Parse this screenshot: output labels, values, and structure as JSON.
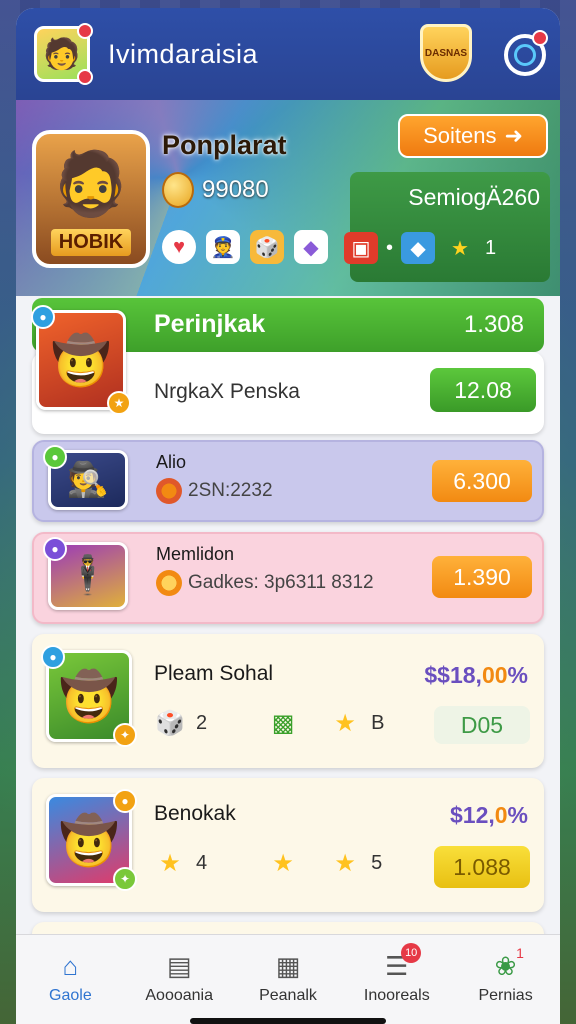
{
  "header": {
    "app_title": "Ivimdaraisia",
    "badge_text": "DASNAS",
    "avatar_icon": "player-avatar"
  },
  "hero": {
    "player_name": "Ponplarat",
    "portrait_tag": "HOBIK",
    "coins": "99080",
    "start_label": "Soitens",
    "start_arrow": "➜",
    "season_label": "SemiogÄ260",
    "season_count": "1",
    "season_dot": "•"
  },
  "ranking": {
    "title": "Perinjkak",
    "value": "1.308"
  },
  "cards": [
    {
      "name": "NrgkaX Penska",
      "pill": "12.08",
      "pill_color": "green"
    },
    {
      "name": "Alio",
      "sub": "2SN:2232",
      "pill": "6.300",
      "pill_color": "orange"
    },
    {
      "name": "Memlidon",
      "sub": "Gadkes: 3p6311 8312",
      "pill": "1.390",
      "pill_color": "orange"
    },
    {
      "name": "Pleam Sohal",
      "perc_a": "$$18,",
      "perc_b": "00",
      "perc_c": "%",
      "item1": "2",
      "item3": "B",
      "pill": "D05",
      "pill_color": "pale"
    },
    {
      "name": "Benokak",
      "perc_a": "$12,",
      "perc_b": "0",
      "perc_c": "%",
      "item1": "4",
      "item3": "5",
      "pill": "1.088",
      "pill_color": "yellow"
    }
  ],
  "bottom_nav": [
    {
      "label": "Gaole",
      "icon": "home-icon",
      "active": true
    },
    {
      "label": "Aoooania",
      "icon": "chart-icon"
    },
    {
      "label": "Peanalk",
      "icon": "notepad-icon"
    },
    {
      "label": "Inooreals",
      "icon": "list-icon",
      "badge": "10"
    },
    {
      "label": "Pernias",
      "icon": "group-icon",
      "badge": "1"
    }
  ]
}
